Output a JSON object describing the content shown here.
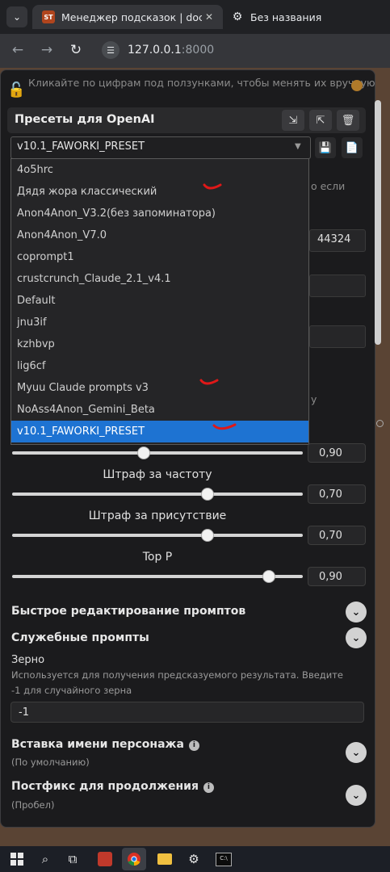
{
  "browser": {
    "tabs": [
      {
        "title": "Менеджер подсказок | docs.ST",
        "favicon": "ST",
        "active": true
      },
      {
        "title": "Без названия",
        "favicon": "gear-icon",
        "active": false
      }
    ],
    "url_host": "127.0.0.1",
    "url_port": ":8000",
    "site_info_icon": "tune-icon"
  },
  "panel": {
    "hint": "Кликайте по цифрам под ползунками, чтобы менять их вручную.",
    "presets_title": "Пресеты для OpenAI",
    "selected_preset": "v10.1_FAWORKI_PRESET",
    "preset_options": [
      "4o5hrc",
      "Дядя жора классический",
      "Anon4Anon_V3.2(без запоминатора)",
      "Anon4Anon_V7.0",
      "coprompt1",
      "crustcrunch_Claude_2.1_v4.1",
      "Default",
      "jnu3if",
      "kzhbvp",
      "lig6cf",
      "Myuu Claude prompts v3",
      "NoAss4Anon_Gemini_Beta",
      "v10.1_FAWORKI_PRESET"
    ],
    "behind_text_1": "о если",
    "behind_value_1": "44324",
    "behind_text_2": "у",
    "sliders": [
      {
        "label": "",
        "value": "0,90",
        "fraction": 0.45
      },
      {
        "label": "Штраф за частоту",
        "value": "0,70",
        "fraction": 0.67
      },
      {
        "label": "Штраф за присутствие",
        "value": "0,70",
        "fraction": 0.67
      },
      {
        "label": "Top P",
        "value": "0,90",
        "fraction": 0.88
      }
    ],
    "quick_edit_title": "Быстрое редактирование промптов",
    "service_prompts_title": "Служебные промпты",
    "seed_label": "Зерно",
    "seed_desc_1": "Используется для получения предсказуемого результата. Введите",
    "seed_desc_2": "-1 для случайного зерна",
    "seed_value": "-1",
    "name_insert_title": "Вставка имени персонажа",
    "name_insert_sub": "(По умолчанию)",
    "continue_postfix_title": "Постфикс для продолжения",
    "continue_postfix_sub": "(Пробел)"
  },
  "colors": {
    "accent_selected": "#1e73d2",
    "annotation_tick": "#e01818"
  },
  "taskbar": {
    "icons": [
      "windows-start-icon",
      "search-icon",
      "task-view-icon",
      "app-icon",
      "chrome-icon",
      "file-explorer-icon",
      "settings-app-icon",
      "terminal-icon"
    ]
  }
}
